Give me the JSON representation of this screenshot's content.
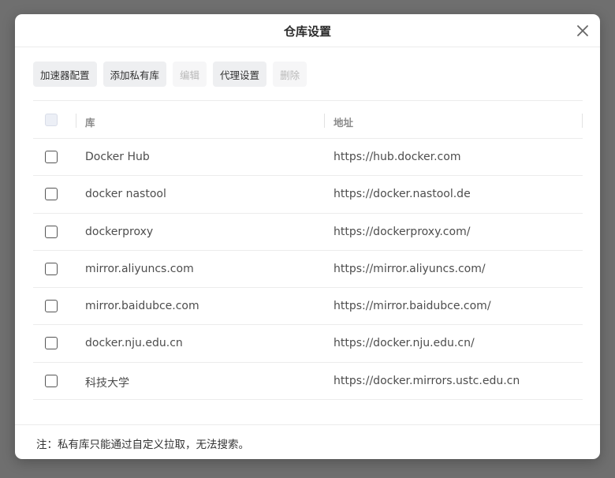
{
  "dialog": {
    "title": "仓库设置",
    "close_icon": "close-icon"
  },
  "toolbar": {
    "buttons": [
      {
        "label": "加速器配置",
        "enabled": true
      },
      {
        "label": "添加私有库",
        "enabled": true
      },
      {
        "label": "编辑",
        "enabled": false
      },
      {
        "label": "代理设置",
        "enabled": true
      },
      {
        "label": "删除",
        "enabled": false
      }
    ]
  },
  "table": {
    "columns": {
      "name": "库",
      "address": "地址"
    },
    "rows": [
      {
        "name": "Docker Hub",
        "address": "https://hub.docker.com"
      },
      {
        "name": "docker nastool",
        "address": "https://docker.nastool.de"
      },
      {
        "name": "dockerproxy",
        "address": "https://dockerproxy.com/"
      },
      {
        "name": "mirror.aliyuncs.com",
        "address": "https://mirror.aliyuncs.com/"
      },
      {
        "name": "mirror.baidubce.com",
        "address": "https://mirror.baidubce.com/"
      },
      {
        "name": "docker.nju.edu.cn",
        "address": "https://docker.nju.edu.cn/"
      },
      {
        "name": "科技大学",
        "address": "https://docker.mirrors.ustc.edu.cn"
      }
    ]
  },
  "footer": {
    "note": "注：私有库只能通过自定义拉取，无法搜索。"
  }
}
